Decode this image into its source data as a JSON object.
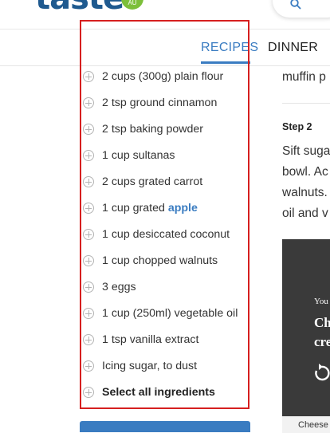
{
  "header": {
    "logo_text": "taste",
    "logo_badge": "AU"
  },
  "tabs": [
    {
      "label": "RECIPES",
      "active": true
    },
    {
      "label": "DINNER",
      "active": false
    }
  ],
  "ingredients": [
    {
      "text": "2 cups (300g) plain flour"
    },
    {
      "text": "2 tsp ground cinnamon"
    },
    {
      "text": "2 tsp baking powder"
    },
    {
      "text": "1 cup sultanas"
    },
    {
      "text": "2 cups grated carrot"
    },
    {
      "prefix": "1 cup grated ",
      "link": "apple"
    },
    {
      "text": "1 cup desiccated coconut"
    },
    {
      "text": "1 cup chopped walnuts"
    },
    {
      "text": "3 eggs"
    },
    {
      "text": "1 cup (250ml) vegetable oil"
    },
    {
      "text": "1 tsp vanilla extract"
    },
    {
      "text": "Icing sugar, to dust"
    }
  ],
  "select_all_label": "Select all ingredients",
  "method": {
    "prev_text": "muffin p",
    "step_label": "Step 2",
    "lines": [
      "Sift suga",
      "bowl. Ac",
      "walnuts.",
      "oil and v"
    ]
  },
  "video": {
    "prefix_text": "You",
    "title_lines": [
      "Ch",
      "cre"
    ],
    "caption": "Cheese"
  },
  "colors": {
    "accent_blue": "#3a7cc1",
    "highlight_red": "#d61f1f",
    "logo_green": "#7cbf3a",
    "logo_navy": "#1f5a8f"
  }
}
